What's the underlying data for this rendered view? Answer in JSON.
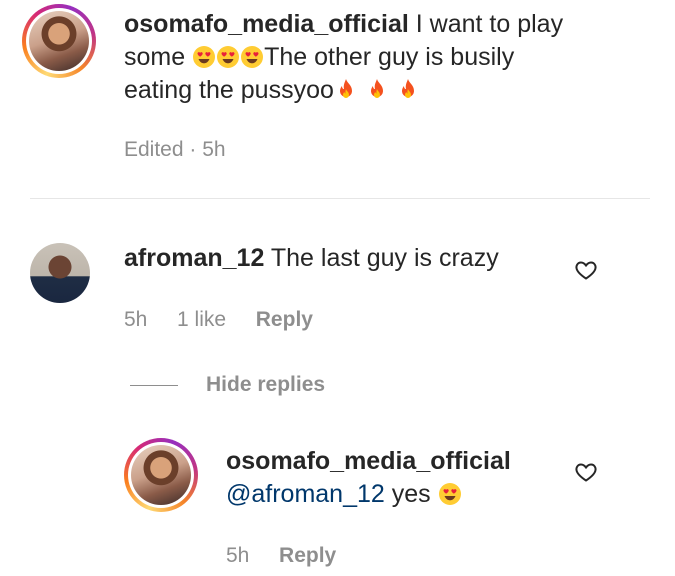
{
  "comment1": {
    "username": "osomafo_media_official",
    "line1_text": "I want to play",
    "line2_prefix": "some",
    "line2_suffix": "The other guy is busily",
    "line3_text": "eating the pussyoo",
    "meta": "Edited · 5h"
  },
  "comment2": {
    "username": "afroman_12",
    "text": "The last guy is crazy",
    "time": "5h",
    "likes": "1 like",
    "reply_label": "Reply"
  },
  "thread": {
    "hide_replies_label": "Hide replies"
  },
  "reply1": {
    "username": "osomafo_media_official",
    "mention": "@afroman_12",
    "text": "yes",
    "time": "5h",
    "reply_label": "Reply"
  },
  "icons": {
    "heart": "heart-outline-icon",
    "emoji_heart_eyes": "smiling-face-with-heart-eyes",
    "emoji_fire": "fire"
  },
  "colors": {
    "text": "#262626",
    "meta": "#8e8e8e",
    "mention": "#00376b",
    "divider": "#e6e6e6"
  }
}
